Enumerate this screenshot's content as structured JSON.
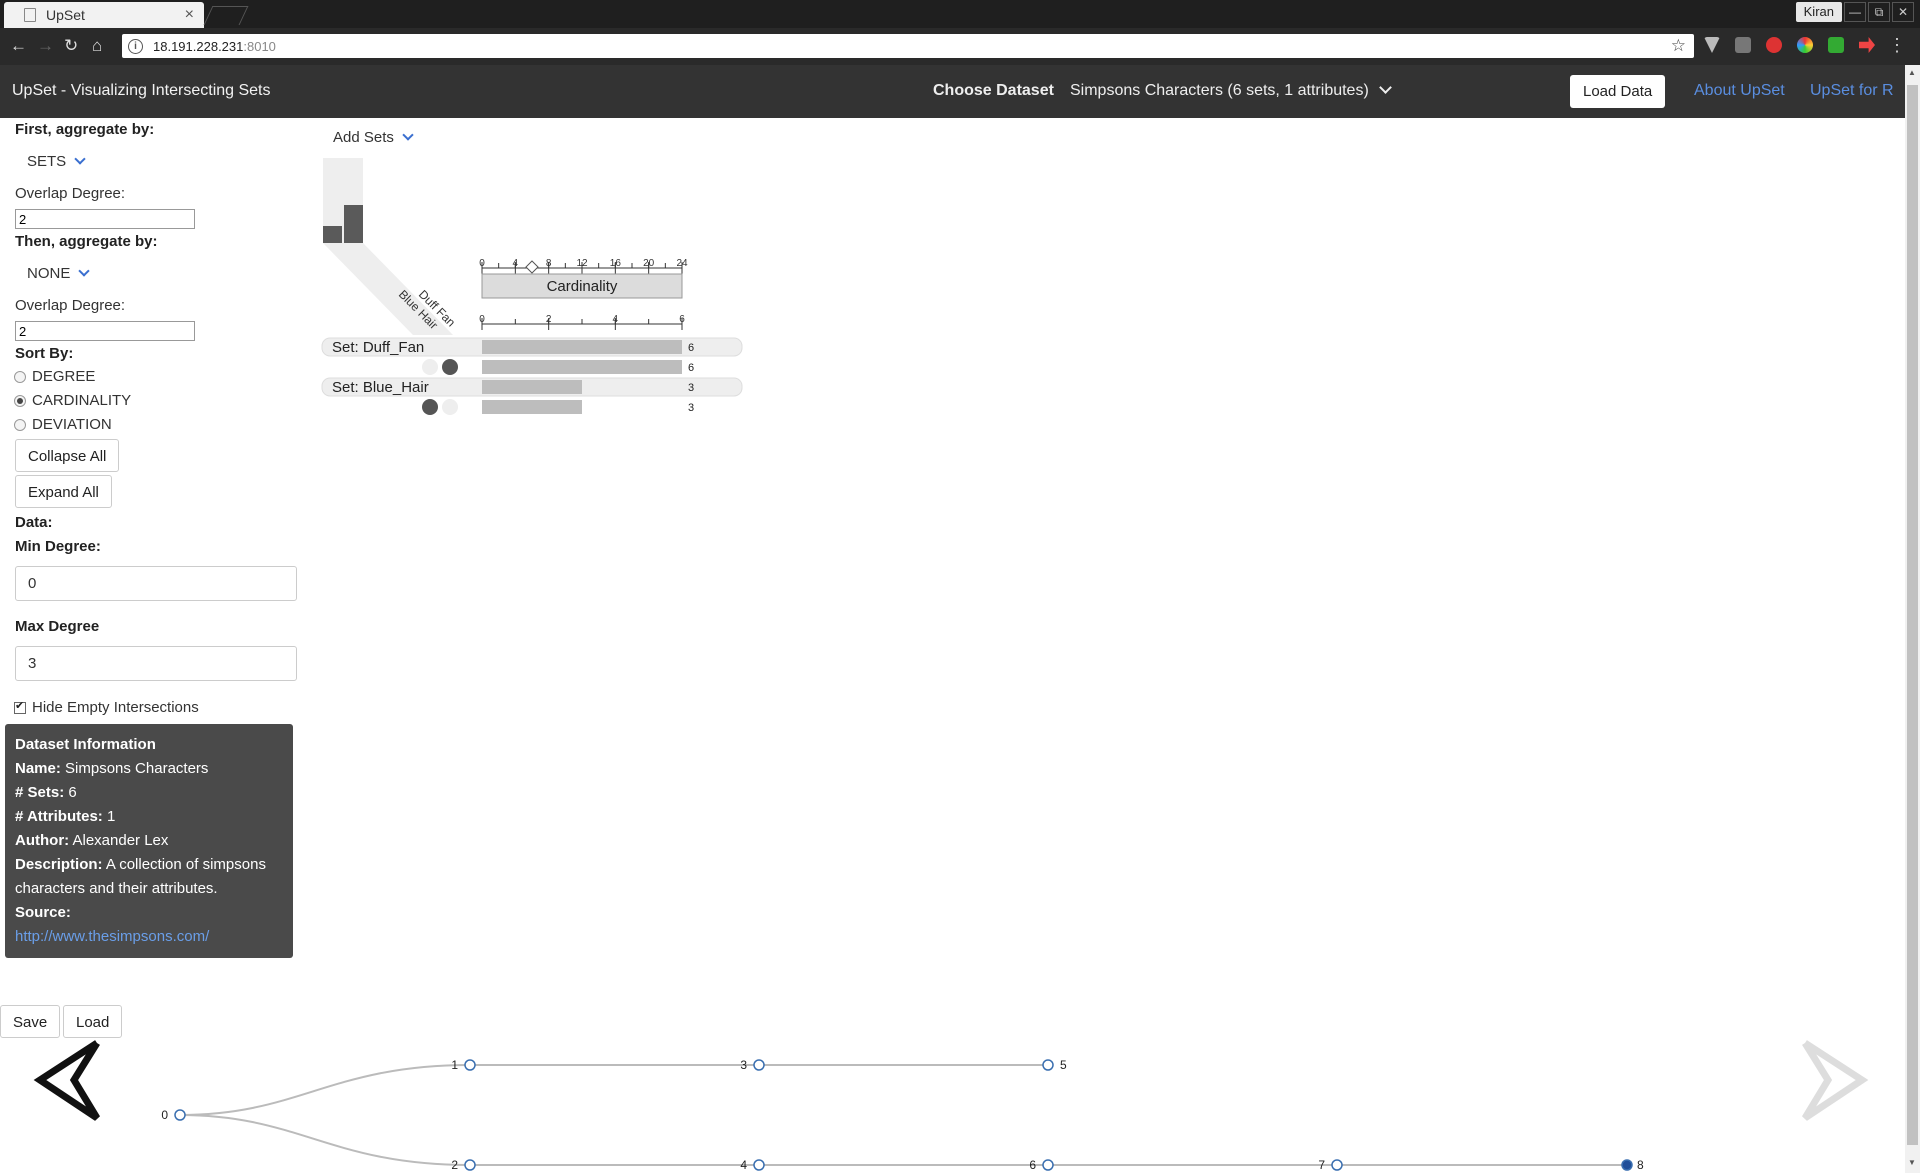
{
  "browser": {
    "tab_title": "UpSet",
    "url_host": "18.191.228.231",
    "url_port": ":8010",
    "profile": "Kiran",
    "win_min": "—",
    "win_restore": "⧉",
    "win_close": "✕"
  },
  "app": {
    "title": "UpSet - Visualizing Intersecting Sets",
    "choose_dataset": "Choose Dataset",
    "dataset": "Simpsons Characters (6 sets, 1 attributes)",
    "load_data": "Load Data",
    "about": "About UpSet",
    "upset_r": "UpSet for R"
  },
  "panel": {
    "first_aggregate_label": "First, aggregate by:",
    "first_aggregate_value": "SETS",
    "overlap_degree_label": "Overlap Degree:",
    "overlap_degree_1": "2",
    "then_aggregate_label": "Then, aggregate by:",
    "then_aggregate_value": "NONE",
    "overlap_degree_2": "2",
    "sort_by_label": "Sort By:",
    "sort_options": [
      "DEGREE",
      "CARDINALITY",
      "DEVIATION"
    ],
    "sort_selected": "CARDINALITY",
    "collapse_all": "Collapse All",
    "expand_all": "Expand All",
    "data_label": "Data:",
    "min_degree_label": "Min Degree:",
    "min_degree": "0",
    "max_degree_label": "Max Degree",
    "max_degree": "3",
    "hide_empty": "Hide Empty Intersections",
    "hide_empty_checked": true
  },
  "dataset_info": {
    "heading": "Dataset Information",
    "name_label": "Name:",
    "name": "Simpsons Characters",
    "sets_label": "# Sets:",
    "sets": "6",
    "attributes_label": "# Attributes:",
    "attributes": "1",
    "author_label": "Author:",
    "author": "Alexander Lex",
    "description_label": "Description:",
    "description_line1": "A collection of simpsons",
    "description_line2": "characters and their attributes.",
    "source_label": "Source:",
    "source": "http://www.thesimpsons.com/"
  },
  "upset": {
    "add_sets": "Add Sets",
    "set_names": [
      "Duff Fan",
      "Blue Hair"
    ],
    "set_sizes_relative": [
      0.2,
      0.45
    ],
    "cardinality_label": "Cardinality",
    "top_axis_ticks": [
      "0",
      "4",
      "8",
      "12",
      "16",
      "20",
      "24"
    ],
    "top_axis_max": 24,
    "top_axis_marker": 6,
    "bottom_axis_ticks": [
      "0",
      "2",
      "4",
      "6"
    ],
    "bottom_axis_max": 6,
    "rows": [
      {
        "type": "group",
        "label": "Set: Duff_Fan",
        "value": 6,
        "value_text": "6"
      },
      {
        "type": "subset",
        "membership": [
          false,
          true
        ],
        "value": 6,
        "value_text": "6"
      },
      {
        "type": "group",
        "label": "Set: Blue_Hair",
        "value": 3,
        "value_text": "3"
      },
      {
        "type": "subset",
        "membership": [
          true,
          false
        ],
        "value": 3,
        "value_text": "3"
      }
    ]
  },
  "bottom": {
    "save": "Save",
    "load": "Load"
  },
  "history_graph": {
    "nodes": [
      {
        "id": "0",
        "col": 0,
        "lane": "mid",
        "active": false
      },
      {
        "id": "1",
        "col": 1,
        "lane": "top",
        "active": false
      },
      {
        "id": "3",
        "col": 2,
        "lane": "top",
        "active": false
      },
      {
        "id": "5",
        "col": 3,
        "lane": "top",
        "active": false
      },
      {
        "id": "2",
        "col": 1,
        "lane": "bottom",
        "active": false
      },
      {
        "id": "4",
        "col": 2,
        "lane": "bottom",
        "active": false
      },
      {
        "id": "6",
        "col": 3,
        "lane": "bottom",
        "active": false
      },
      {
        "id": "7",
        "col": 4,
        "lane": "bottom",
        "active": false
      },
      {
        "id": "8",
        "col": 5,
        "lane": "bottom",
        "active": true
      }
    ],
    "edges": [
      [
        "0",
        "1"
      ],
      [
        "1",
        "3"
      ],
      [
        "3",
        "5"
      ],
      [
        "0",
        "2"
      ],
      [
        "2",
        "4"
      ],
      [
        "4",
        "6"
      ],
      [
        "6",
        "7"
      ],
      [
        "7",
        "8"
      ]
    ]
  },
  "colors": {
    "bar": "#bdbdbd",
    "dot_on": "#555555",
    "dot_off": "#eeeeee",
    "active_node": "#1f4e99",
    "node_stroke": "#3a6fb0"
  }
}
